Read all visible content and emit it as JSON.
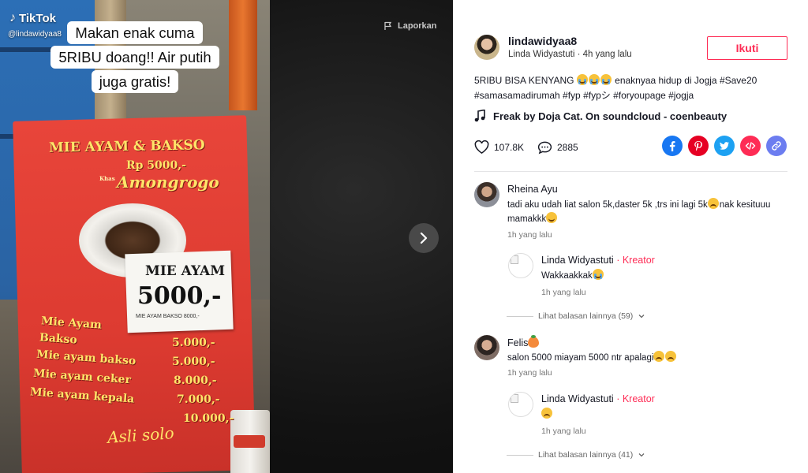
{
  "video": {
    "watermark_brand": "TikTok",
    "watermark_handle": "@lindawidyaa8",
    "caption_lines": [
      "Makan enak cuma",
      "5RIBU doang!! Air putih",
      "juga gratis!"
    ],
    "report_label": "Laporkan",
    "sign": {
      "title": "MIE AYAM  &  BAKSO",
      "price": "Rp 5000,-",
      "khas": "Khas",
      "subtitle": "Amongrogo",
      "card_line1": "MIE AYAM",
      "card_line2": "5000,-",
      "card_line3": "MIE AYAM BAKSO    8000,-",
      "menu": [
        {
          "item": "Mie Ayam",
          "price": ""
        },
        {
          "item": "Bakso",
          "price": "5.000,-"
        },
        {
          "item": "Mie ayam bakso",
          "price": "5.000,-"
        },
        {
          "item": "Mie ayam ceker",
          "price": "8.000,-"
        },
        {
          "item": "Mie ayam kepala",
          "price": "7.000,-"
        },
        {
          "item": "",
          "price": "10.000,-"
        }
      ],
      "footer": "Asli solo"
    }
  },
  "author": {
    "username": "lindawidyaa8",
    "display_name": "Linda Widyastuti",
    "separator": "·",
    "time_ago": "4h yang lalu",
    "follow_label": "Ikuti"
  },
  "description": {
    "text_start": "5RIBU BISA KENYANG ",
    "text_mid": " enaknyaa hidup di Jogja ",
    "hashtags_line1": "#Save20",
    "hashtags_line2": "#samasamadirumah #fyp #fypシ #foryoupage #jogja"
  },
  "music": {
    "title": "Freak by Doja Cat. On soundcloud - coenbeauty"
  },
  "stats": {
    "likes": "107.8K",
    "comments": "2885"
  },
  "share_icons": [
    "facebook-icon",
    "pinterest-icon",
    "twitter-icon",
    "embed-icon",
    "link-icon"
  ],
  "colors": {
    "accent": "#fe2c55",
    "facebook": "#1877f2",
    "pinterest": "#e60023",
    "twitter": "#1da1f2",
    "embed": "#fe2c55",
    "link": "#6c7df0"
  },
  "comments": [
    {
      "name": "Rheina Ayu",
      "text_a": "tadi aku udah liat salon 5k,daster 5k ,trs ini lagi 5k",
      "text_b": "nak kesituuu mamakkk",
      "time": "1h yang lalu",
      "reply": {
        "name": "Linda Widyastuti",
        "badge": " · Kreator",
        "text": "Wakkaakkak",
        "time": "1h yang lalu"
      },
      "more": "Lihat balasan lainnya (59)"
    },
    {
      "name": "Felis",
      "text": "salon 5000 miayam 5000 ntr apalagi",
      "time": "1h yang lalu",
      "reply": {
        "name": "Linda Widyastuti",
        "badge": " · Kreator",
        "text": "",
        "time": "1h yang lalu"
      },
      "more": "Lihat balasan lainnya (41)"
    }
  ]
}
